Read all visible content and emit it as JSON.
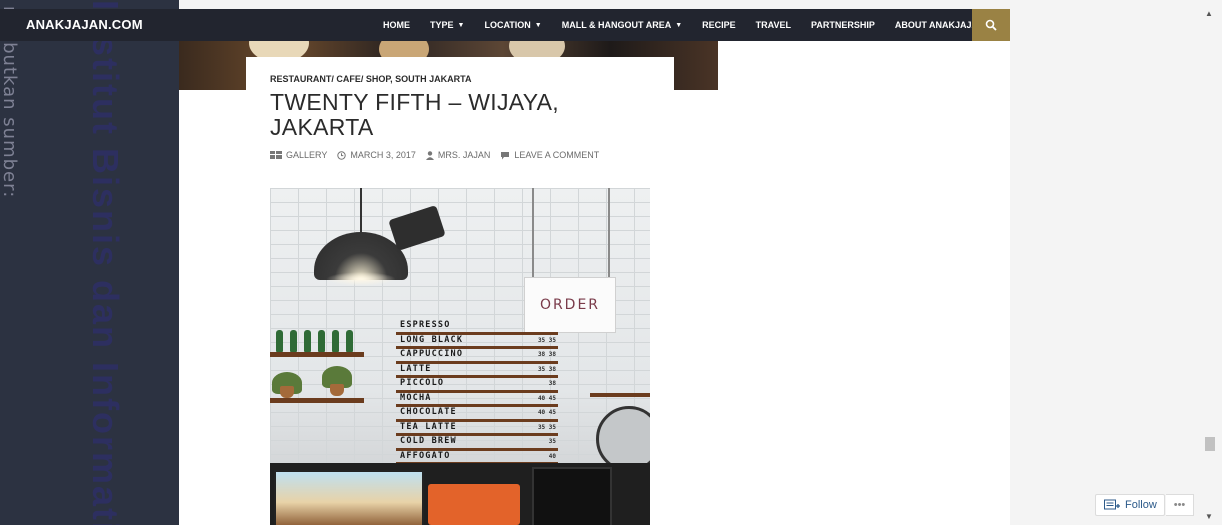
{
  "watermark": {
    "side_text": "nyebutkan sumber:",
    "main_text": "Institut Bisnis dan Informatika"
  },
  "header": {
    "site_title": "ANAKJAJAN.COM",
    "nav": [
      {
        "label": "HOME",
        "has_dropdown": false
      },
      {
        "label": "TYPE",
        "has_dropdown": true
      },
      {
        "label": "LOCATION",
        "has_dropdown": true
      },
      {
        "label": "MALL & HANGOUT AREA",
        "has_dropdown": true
      },
      {
        "label": "RECIPE",
        "has_dropdown": false
      },
      {
        "label": "TRAVEL",
        "has_dropdown": false
      },
      {
        "label": "PARTNERSHIP",
        "has_dropdown": false
      },
      {
        "label": "ABOUT ANAKJAJAN",
        "has_dropdown": false
      }
    ],
    "search_icon": "search-icon",
    "colors": {
      "bar": "#22252f",
      "search": "#9a8244"
    }
  },
  "post": {
    "categories": "RESTAURANT/ CAFE/ SHOP, SOUTH JAKARTA",
    "title": "TWENTY FIFTH – WIJAYA, JAKARTA",
    "meta": {
      "format": "GALLERY",
      "date": "MARCH 3, 2017",
      "author": "MRS. JAJAN",
      "comment": "LEAVE A COMMENT"
    }
  },
  "photo": {
    "order_sign": "ORDER",
    "menu_items": [
      {
        "name": "ESPRESSO",
        "price": ""
      },
      {
        "name": "LONG BLACK",
        "price": "35 35"
      },
      {
        "name": "CAPPUCCINO",
        "price": "38 38"
      },
      {
        "name": "LATTE",
        "price": "35 38"
      },
      {
        "name": "PICCOLO",
        "price": "38"
      },
      {
        "name": "MOCHA",
        "price": "40 45"
      },
      {
        "name": "CHOCOLATE",
        "price": "40 45"
      },
      {
        "name": "TEA LATTE",
        "price": "35 35"
      },
      {
        "name": "COLD BREW",
        "price": "35"
      },
      {
        "name": "AFFOGATO",
        "price": "40"
      }
    ]
  },
  "follow_widget": {
    "label": "Follow",
    "more": "•••"
  }
}
